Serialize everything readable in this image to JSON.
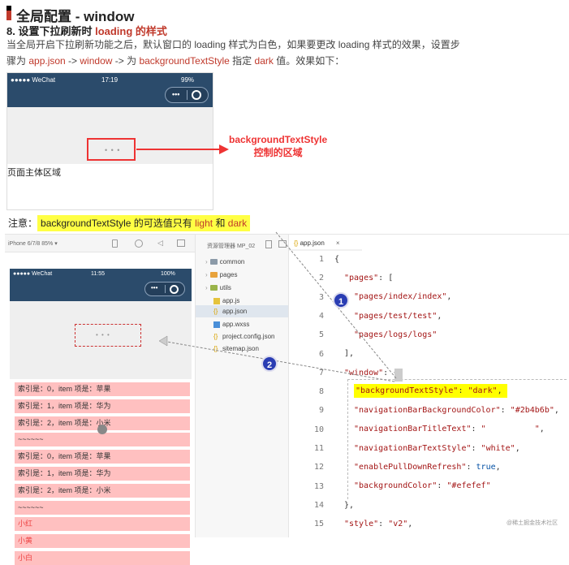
{
  "header": {
    "title": "全局配置 - window",
    "subtitle_prefix": "8. 设置下拉刷新时 ",
    "subtitle_red": "loading 的样式",
    "para1": "当全局开启下拉刷新功能之后，默认窗口的 loading 样式为白色，如果要更改 loading 样式的效果，设置步",
    "para2_a": "骤为 ",
    "para2_b": "app.json",
    "para2_c": " -> ",
    "para2_d": "window",
    "para2_e": " -> 为 ",
    "para2_f": "backgroundTextStyle",
    "para2_g": " 指定 ",
    "para2_h": "dark",
    "para2_i": " 值。效果如下："
  },
  "phone_top": {
    "carrier": "●●●●● WeChat",
    "time": "17:19",
    "battery": "99%",
    "dots": "• • •",
    "body_label": "页面主体区域"
  },
  "annotation": {
    "line1": "backgroundTextStyle",
    "line2": "控制的区域"
  },
  "note": {
    "prefix": "注意：",
    "a": "backgroundTextStyle 的可选值只有 ",
    "b": "light",
    "c": " 和 ",
    "d": "dark"
  },
  "simulator": {
    "device": "iPhone 6/7/8 85% ▾",
    "carrier": "●●●●● WeChat",
    "time": "11:55",
    "battery": "100%",
    "rows": [
      "索引是：0，item 项是：苹果",
      "索引是：1，item 项是：华为",
      "索引是：2，item 项是：小米",
      "~~~~~~",
      "索引是：0，item 项是：苹果",
      "索引是：1，item 项是：华为",
      "索引是：2，item 项是：小米",
      "~~~~~~",
      "小红",
      "小黄",
      "小白"
    ]
  },
  "explorer": {
    "header": "资源管理器  MP_02",
    "items": [
      "common",
      "pages",
      "utils",
      "app.js",
      "app.json",
      "app.wxss",
      "project.config.json",
      "sitemap.json"
    ]
  },
  "editor": {
    "tab_label": "app.json",
    "line_numbers": [
      "1",
      "2",
      "3",
      "4",
      "5",
      "6",
      "7",
      "8",
      "9",
      "10",
      "11",
      "12",
      "13",
      "14",
      "15"
    ],
    "code": {
      "l1": "{",
      "l2_key": "\"pages\"",
      "l2_rest": ": [",
      "l3": "\"pages/index/index\"",
      "l4": "\"pages/test/test\"",
      "l5": "\"pages/logs/logs\"",
      "l6": "],",
      "l7_key": "\"window\"",
      "l7_rest": ": {",
      "l8_key": "\"backgroundTextStyle\"",
      "l8_val": "\"dark\"",
      "l9_key": "\"navigationBarBackgroundColor\"",
      "l9_val": "\"#2b4b6b\"",
      "l10_key": "\"navigationBarTitleText\"",
      "l10_val": "\"          \"",
      "l11_key": "\"navigationBarTextStyle\"",
      "l11_val": "\"white\"",
      "l12_key": "\"enablePullDownRefresh\"",
      "l12_val": "true",
      "l13_key": "\"backgroundColor\"",
      "l13_val": "\"#efefef\"",
      "l14": "},",
      "l15_key": "\"style\"",
      "l15_val": "\"v2\""
    }
  },
  "badges": [
    "1",
    "2"
  ],
  "watermark": "@稀土掘金技术社区",
  "colors": {
    "nav": "#2b4b6b",
    "page_bg": "#efefef",
    "accent_red": "#c0392b",
    "highlight": "#ffff44"
  }
}
